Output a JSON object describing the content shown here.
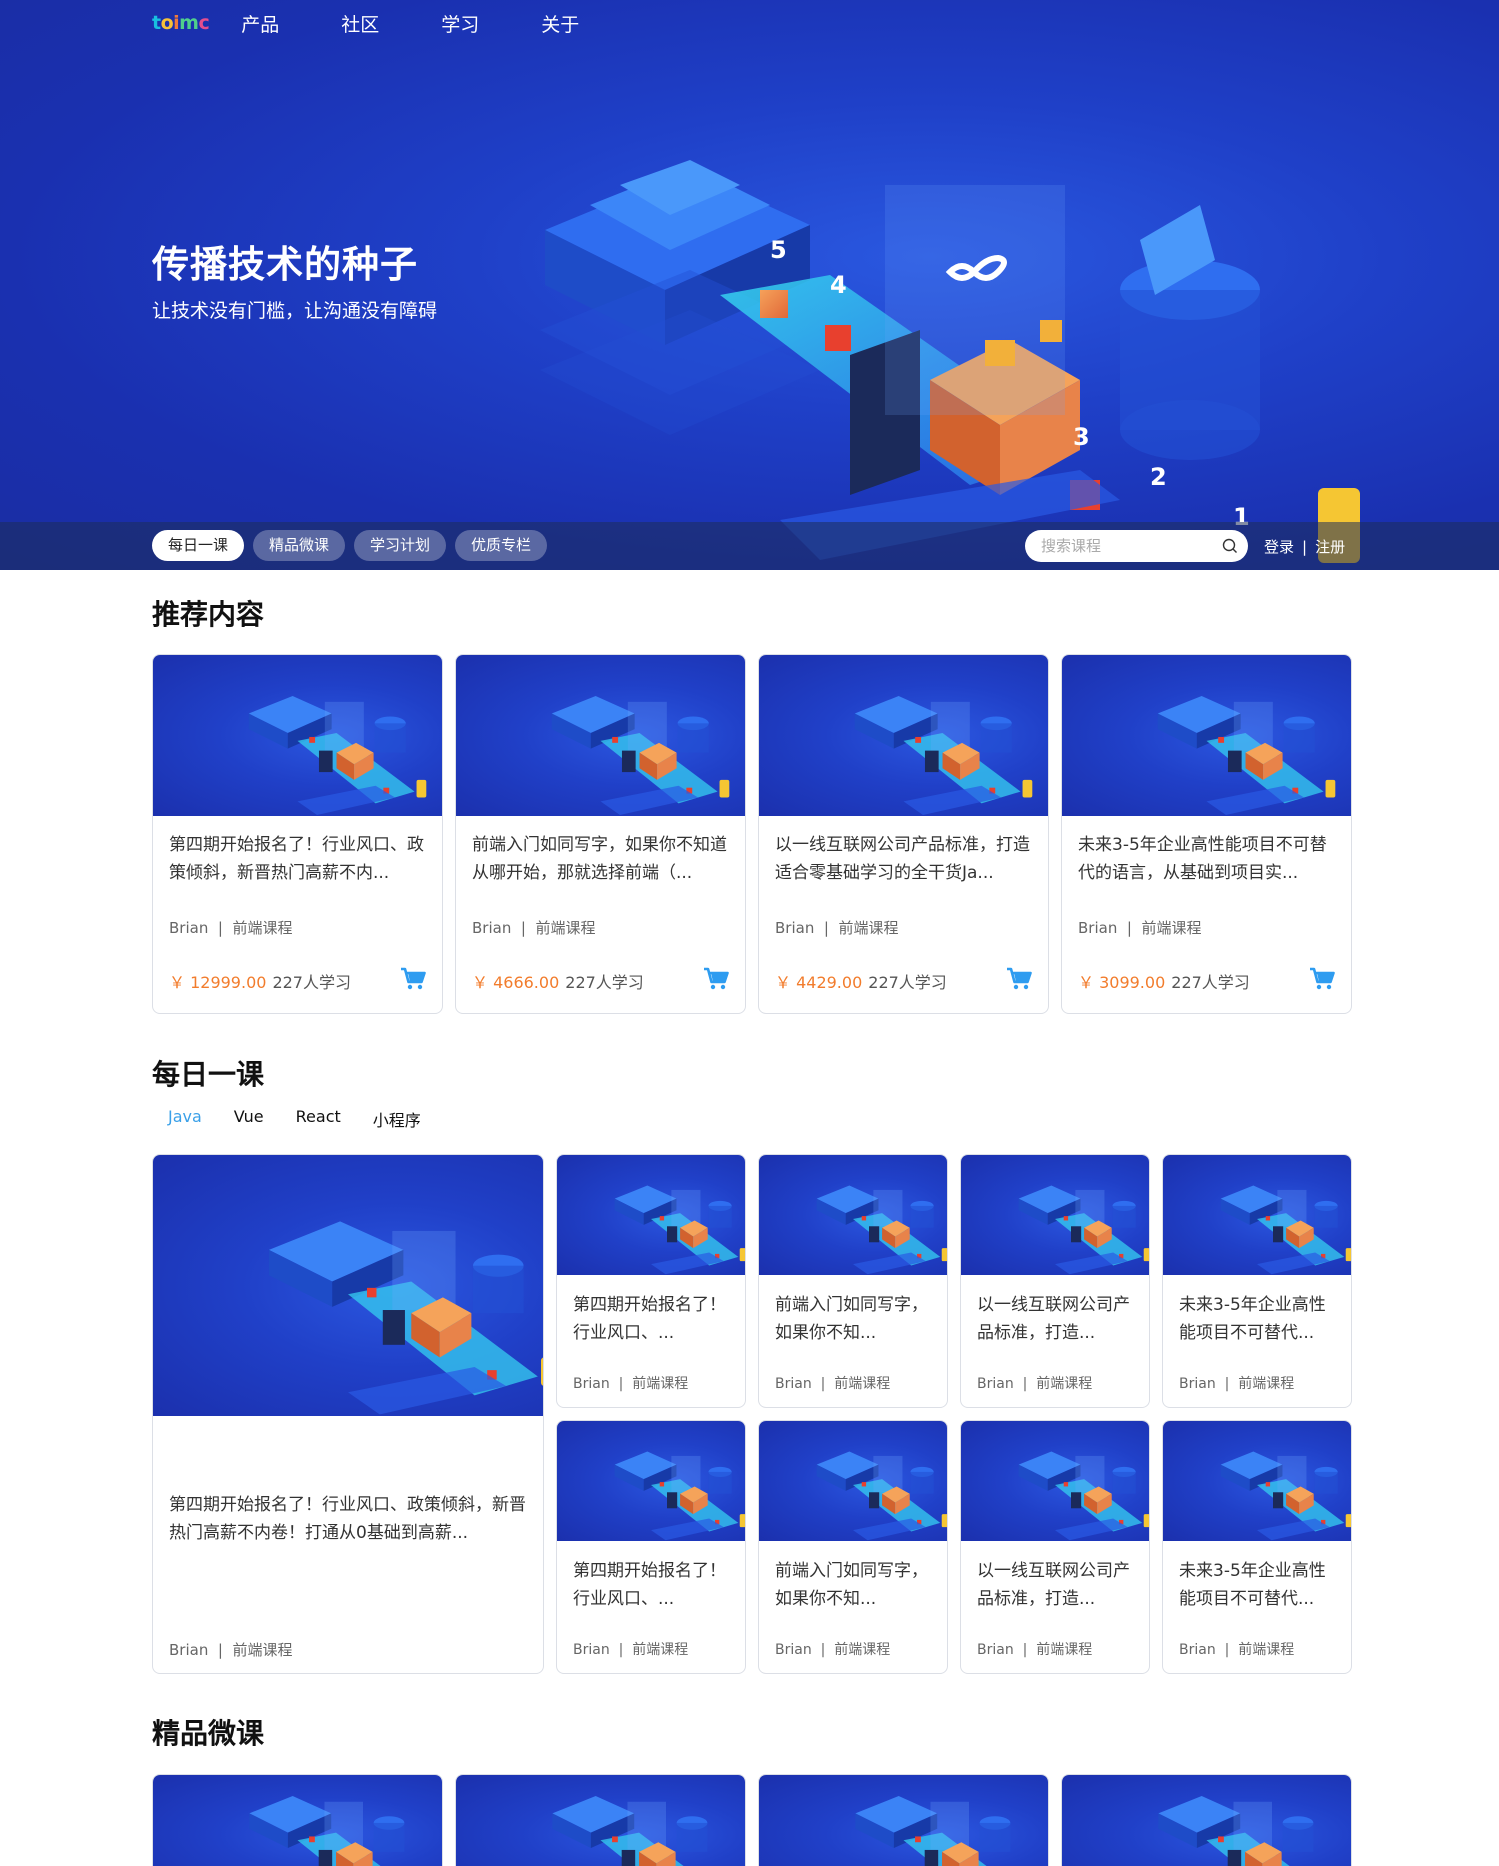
{
  "nav": {
    "logo": [
      "t",
      "o",
      "i",
      "m",
      "c"
    ],
    "links": [
      "产品",
      "社区",
      "学习",
      "关于"
    ]
  },
  "hero": {
    "title": "传播技术的种子",
    "subtitle": "让技术没有门槛，让沟通没有障碍",
    "pills": [
      "每日一课",
      "精品微课",
      "学习计划",
      "优质专栏"
    ],
    "active_pill": 0,
    "search_placeholder": "搜索课程",
    "login": "登录",
    "separator": "|",
    "register": "注册",
    "art_numbers": [
      "5",
      "4",
      "3",
      "2",
      "1"
    ]
  },
  "recommended": {
    "title": "推荐内容",
    "cards": [
      {
        "title": "第四期开始报名了！行业风口、政策倾斜，新晋热门高薪不内...",
        "author": "Brian",
        "category": "前端课程",
        "price": "￥ 12999.00",
        "learners": "227人学习"
      },
      {
        "title": "前端入门如同写字，如果你不知道从哪开始，那就选择前端（...",
        "author": "Brian",
        "category": "前端课程",
        "price": "￥ 4666.00",
        "learners": "227人学习"
      },
      {
        "title": "以一线互联网公司产品标准，打造适合零基础学习的全干货Ja...",
        "author": "Brian",
        "category": "前端课程",
        "price": "￥ 4429.00",
        "learners": "227人学习"
      },
      {
        "title": "未来3-5年企业高性能项目不可替代的语言，从基础到项目实...",
        "author": "Brian",
        "category": "前端课程",
        "price": "￥ 3099.00",
        "learners": "227人学习"
      }
    ]
  },
  "daily": {
    "title": "每日一课",
    "tabs": [
      "Java",
      "Vue",
      "React",
      "小程序"
    ],
    "active_tab": 0,
    "featured": {
      "title": "第四期开始报名了！行业风口、政策倾斜，新晋热门高薪不内卷！打通从0基础到高薪...",
      "author": "Brian",
      "category": "前端课程"
    },
    "cards": [
      {
        "title": "第四期开始报名了！行业风口、...",
        "author": "Brian",
        "category": "前端课程"
      },
      {
        "title": "前端入门如同写字，如果你不知...",
        "author": "Brian",
        "category": "前端课程"
      },
      {
        "title": "以一线互联网公司产品标准，打造...",
        "author": "Brian",
        "category": "前端课程"
      },
      {
        "title": "未来3-5年企业高性能项目不可替代...",
        "author": "Brian",
        "category": "前端课程"
      },
      {
        "title": "第四期开始报名了！行业风口、...",
        "author": "Brian",
        "category": "前端课程"
      },
      {
        "title": "前端入门如同写字，如果你不知...",
        "author": "Brian",
        "category": "前端课程"
      },
      {
        "title": "以一线互联网公司产品标准，打造...",
        "author": "Brian",
        "category": "前端课程"
      },
      {
        "title": "未来3-5年企业高性能项目不可替代...",
        "author": "Brian",
        "category": "前端课程"
      }
    ]
  },
  "premium": {
    "title": "精品微课",
    "count": 4
  },
  "colors": {
    "hero_blue": "#1f40c8",
    "price_orange": "#f27c2c",
    "cart_blue": "#2e9cf0",
    "tab_active": "#3aa0e8"
  },
  "icons": {
    "search": "search-icon",
    "cart": "cart-icon"
  }
}
